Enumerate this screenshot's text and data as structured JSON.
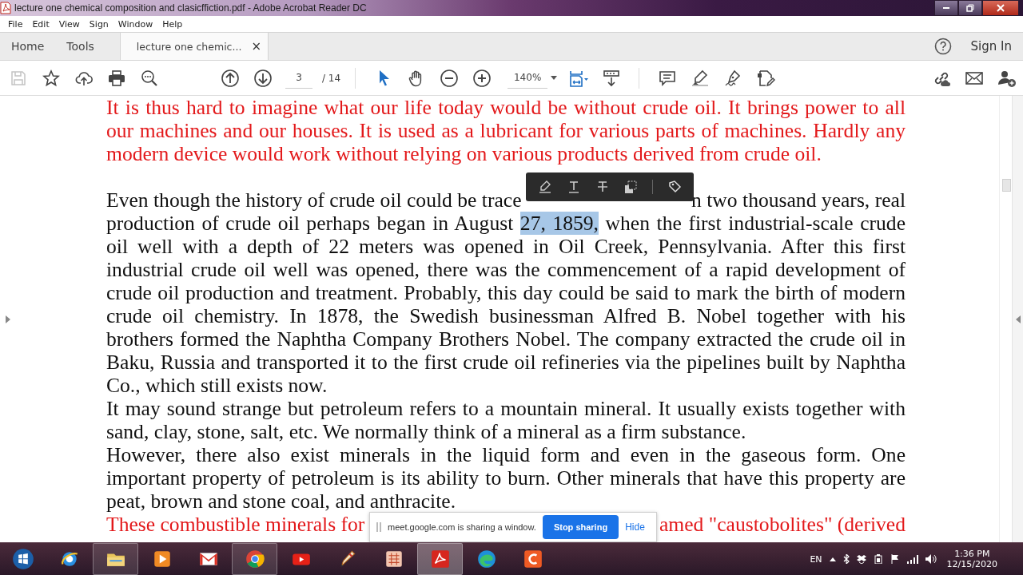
{
  "window": {
    "title": "lecture one chemical composition and clasicffiction.pdf - Adobe Acrobat Reader DC"
  },
  "menu": [
    "File",
    "Edit",
    "View",
    "Sign",
    "Window",
    "Help"
  ],
  "tabs": [
    {
      "label": "Home",
      "selected": false
    },
    {
      "label": "Tools",
      "selected": false
    },
    {
      "label": "lecture one chemic...",
      "selected": true,
      "close": "×"
    }
  ],
  "account": {
    "sign_in": "Sign In"
  },
  "toolbar": {
    "save_disabled": true,
    "page": "3",
    "page_count": "/ 14",
    "zoom": "140%",
    "select_tool_active": true
  },
  "document": {
    "paragraphs": [
      {
        "color": "#e3191b",
        "lines": [
          {
            "segments": [
              {
                "text": "It is thus hard to imagine what our life today would be without crude oil. It brings power to all"
              }
            ]
          },
          {
            "segments": [
              {
                "text": "our machines and our houses. It is used as a lubricant for various parts of machines. Hardly any"
              }
            ]
          },
          {
            "segments": [
              {
                "text": "modern device would work without relying on various products derived from crude oil."
              }
            ]
          }
        ]
      },
      {
        "color": "#111111",
        "gap_before": true,
        "lines": [
          {
            "covered": true,
            "segments": [
              {
                "text": "Even though the history of crude oil could be trace"
              },
              {
                "text": "n two thousand years, real"
              }
            ]
          },
          {
            "segments": [
              {
                "text": "production of crude oil perhaps began in August ",
                "selected": false
              },
              {
                "text": "27, 1859,",
                "selected": true
              },
              {
                "text": " when the first industrial-scale crude",
                "selected": false
              }
            ]
          },
          {
            "segments": [
              {
                "text": "oil well with a depth of 22 meters was opened in Oil Creek, Pennsylvania. After this first"
              }
            ]
          },
          {
            "segments": [
              {
                "text": "industrial crude oil well was opened, there was the commencement of a rapid development of"
              }
            ]
          },
          {
            "segments": [
              {
                "text": "crude oil production and treatment. Probably, this day could be said to mark the birth of modern"
              }
            ]
          },
          {
            "segments": [
              {
                "text": "crude oil chemistry. In 1878, the Swedish businessman Alfred B. Nobel together with his"
              }
            ]
          },
          {
            "segments": [
              {
                "text": "brothers formed the Naphtha Company Brothers Nobel. The company extracted the crude oil in"
              }
            ]
          },
          {
            "segments": [
              {
                "text": "Baku, Russia and transported it to the first crude oil refineries via the pipelines built by Naphtha"
              }
            ]
          },
          {
            "segments": [
              {
                "text": "Co., which still exists now."
              }
            ]
          }
        ]
      },
      {
        "color": "#111111",
        "lines": [
          {
            "segments": [
              {
                "text": "It may sound strange but petroleum refers to a mountain mineral. It usually exists together with"
              }
            ]
          },
          {
            "segments": [
              {
                "text": "sand, clay, stone, salt, etc. We normally think of a mineral as a firm substance."
              }
            ]
          }
        ]
      },
      {
        "color": "#111111",
        "lines": [
          {
            "segments": [
              {
                "text": "However, there also exist minerals in the liquid form and even in the gaseous form. One"
              }
            ]
          },
          {
            "segments": [
              {
                "text": "important property of petroleum is its ability to burn. Other minerals that have this property are"
              }
            ]
          },
          {
            "segments": [
              {
                "text": "peat, brown and stone coal, and anthracite."
              }
            ]
          }
        ]
      },
      {
        "color": "#e3191b",
        "lines": [
          {
            "covered": true,
            "segments": [
              {
                "text": "These combustible minerals for"
              },
              {
                "text": "amed \"caustobolites\" (derived"
              }
            ]
          }
        ]
      }
    ]
  },
  "sharing_bar": {
    "message": "meet.google.com is sharing a window.",
    "stop_button": "Stop sharing",
    "hide_link": "Hide"
  },
  "taskbar": {
    "apps": [
      {
        "kind": "start",
        "running": false,
        "selected": false
      },
      {
        "kind": "ie",
        "running": false,
        "selected": false
      },
      {
        "kind": "folder",
        "running": true,
        "selected": false
      },
      {
        "kind": "media",
        "running": false,
        "selected": false
      },
      {
        "kind": "mail",
        "running": false,
        "selected": false
      },
      {
        "kind": "chrome",
        "running": true,
        "selected": false
      },
      {
        "kind": "video",
        "running": false,
        "selected": false
      },
      {
        "kind": "paint",
        "running": false,
        "selected": false
      },
      {
        "kind": "grid",
        "running": false,
        "selected": false
      },
      {
        "kind": "pdf",
        "running": true,
        "selected": true
      },
      {
        "kind": "edge",
        "running": false,
        "selected": false
      },
      {
        "kind": "recorder",
        "running": false,
        "selected": false
      }
    ],
    "language": "EN",
    "time": "1:36 PM",
    "date": "12/15/2020"
  }
}
